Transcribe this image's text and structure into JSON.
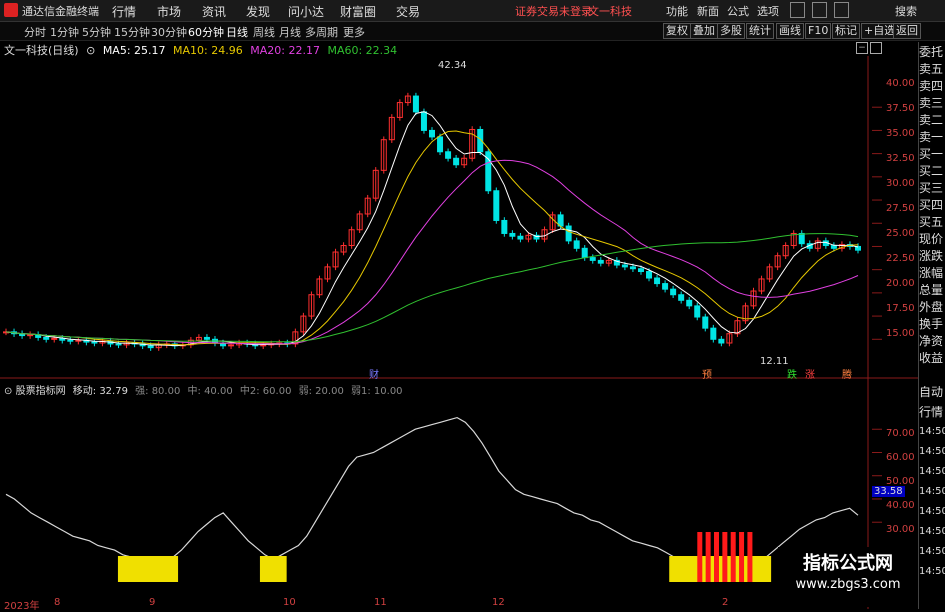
{
  "app": {
    "title": "通达信金融终端"
  },
  "menu": [
    "行情",
    "市场",
    "资讯",
    "发现",
    "问小达",
    "财富圈",
    "交易"
  ],
  "notice": "证券交易未登录",
  "stock_link": "文一科技",
  "right_menu": [
    "功能",
    "新面",
    "公式",
    "选项"
  ],
  "search_label": "搜索",
  "periods": [
    "分时",
    "1分钟",
    "5分钟",
    "15分钟",
    "30分钟",
    "60分钟",
    "日线",
    "周线",
    "月线",
    "多周期",
    "更多"
  ],
  "active_period": "日线",
  "toolbar_buttons": [
    "复权",
    "叠加",
    "多股",
    "统计",
    "画线",
    "F10",
    "标记",
    "+自选",
    "返回"
  ],
  "ma_info": {
    "title": "文一科技(日线)",
    "ma5": "MA5: 25.17",
    "ma10": "MA10: 24.96",
    "ma20": "MA20: 22.17",
    "ma60": "MA60: 22.34"
  },
  "price_axis": [
    "40.00",
    "37.50",
    "35.00",
    "32.50",
    "30.00",
    "27.50",
    "25.00",
    "22.50",
    "20.00",
    "17.50",
    "15.00"
  ],
  "price_annotations": {
    "high": "42.34",
    "low": "12.11"
  },
  "event_markers": [
    "财",
    "预",
    "跌",
    "涨",
    "腾"
  ],
  "indicator_info": {
    "name": "股票指标网",
    "move": "移动: 32.79",
    "p1": "强: 80.00",
    "p2": "中: 40.00",
    "p3": "中2: 60.00",
    "p4": "弱: 20.00",
    "p5": "弱1: 10.00"
  },
  "indicator_axis": [
    "70.00",
    "60.00",
    "50.00",
    "40.00",
    "30.00"
  ],
  "current_value": "33.58",
  "date_axis": [
    "2023年",
    "8",
    "9",
    "10",
    "11",
    "12",
    "2"
  ],
  "side_panel": [
    "委托",
    "卖五",
    "卖四",
    "卖三",
    "卖二",
    "卖一",
    "买一",
    "买二",
    "买三",
    "买四",
    "买五",
    "现价",
    "涨跌",
    "涨幅",
    "总量",
    "外盘",
    "换手",
    "净资",
    "收益"
  ],
  "side_panel2": [
    "自动",
    "行情",
    "14:50",
    "14:50",
    "14:50",
    "14:50",
    "14:50",
    "14:50",
    "14:50",
    "14:50"
  ],
  "watermark": {
    "title": "指标公式网",
    "url": "www.zbgs3.com"
  },
  "colors": {
    "up": "#ff3030",
    "down": "#00e5e5",
    "ma5": "#ffffff",
    "ma10": "#e6c800",
    "ma20": "#e040e0",
    "ma60": "#30c030",
    "accent": "#ff5050"
  },
  "chart_data": {
    "type": "line",
    "title": "文一科技(日线)",
    "price_range": [
      12.11,
      42.34
    ],
    "close": [
      15.8,
      15.6,
      15.4,
      15.5,
      15.2,
      15.0,
      15.1,
      14.9,
      14.8,
      14.9,
      14.7,
      14.6,
      14.8,
      14.5,
      14.4,
      14.6,
      14.5,
      14.3,
      14.1,
      14.4,
      14.5,
      14.3,
      14.4,
      14.9,
      15.2,
      15.0,
      14.6,
      14.3,
      14.4,
      14.6,
      14.5,
      14.3,
      14.4,
      14.5,
      14.6,
      14.5,
      15.8,
      17.5,
      19.8,
      21.5,
      22.8,
      24.4,
      25.1,
      26.8,
      28.5,
      30.2,
      33.2,
      36.5,
      38.9,
      40.5,
      41.2,
      39.5,
      37.5,
      36.8,
      35.2,
      34.5,
      33.8,
      34.5,
      37.6,
      35.2,
      31.0,
      27.8,
      26.4,
      26.1,
      25.8,
      26.2,
      25.8,
      26.8,
      28.4,
      27.2,
      25.6,
      24.8,
      23.8,
      23.5,
      23.2,
      23.5,
      23.0,
      22.8,
      22.6,
      22.3,
      21.6,
      21.0,
      20.4,
      19.8,
      19.2,
      18.6,
      17.4,
      16.2,
      15.0,
      14.6,
      15.6,
      17.0,
      18.6,
      20.2,
      21.5,
      22.8,
      24.0,
      25.1,
      26.4,
      25.3,
      24.8,
      25.6,
      25.1,
      24.8,
      25.2,
      25.0,
      24.6
    ],
    "indicator": {
      "name": "股票指标网",
      "ylim": [
        0,
        80
      ],
      "levels": {
        "强": 80,
        "中": 40,
        "中2": 60,
        "弱": 20,
        "弱1": 10
      },
      "move": [
        42,
        40,
        37,
        34,
        32,
        30,
        28,
        26,
        24,
        23,
        22,
        20,
        19,
        18,
        16,
        15,
        14,
        12,
        11,
        13,
        15,
        18,
        22,
        26,
        29,
        32,
        34,
        30,
        26,
        22,
        19,
        16,
        14,
        16,
        18,
        20,
        24,
        30,
        36,
        42,
        48,
        54,
        58,
        59,
        60,
        62,
        64,
        66,
        68,
        70,
        71,
        72,
        73,
        74,
        75,
        73,
        69,
        64,
        58,
        52,
        48,
        44,
        42,
        41,
        40,
        39,
        38,
        36,
        34,
        33,
        31,
        30,
        28,
        26,
        24,
        22,
        21,
        20,
        19,
        17,
        15,
        13,
        12,
        10,
        9,
        8,
        7,
        6,
        8,
        10,
        12,
        15,
        18,
        21,
        24,
        27,
        29,
        31,
        32,
        34,
        35,
        36,
        33
      ]
    }
  }
}
